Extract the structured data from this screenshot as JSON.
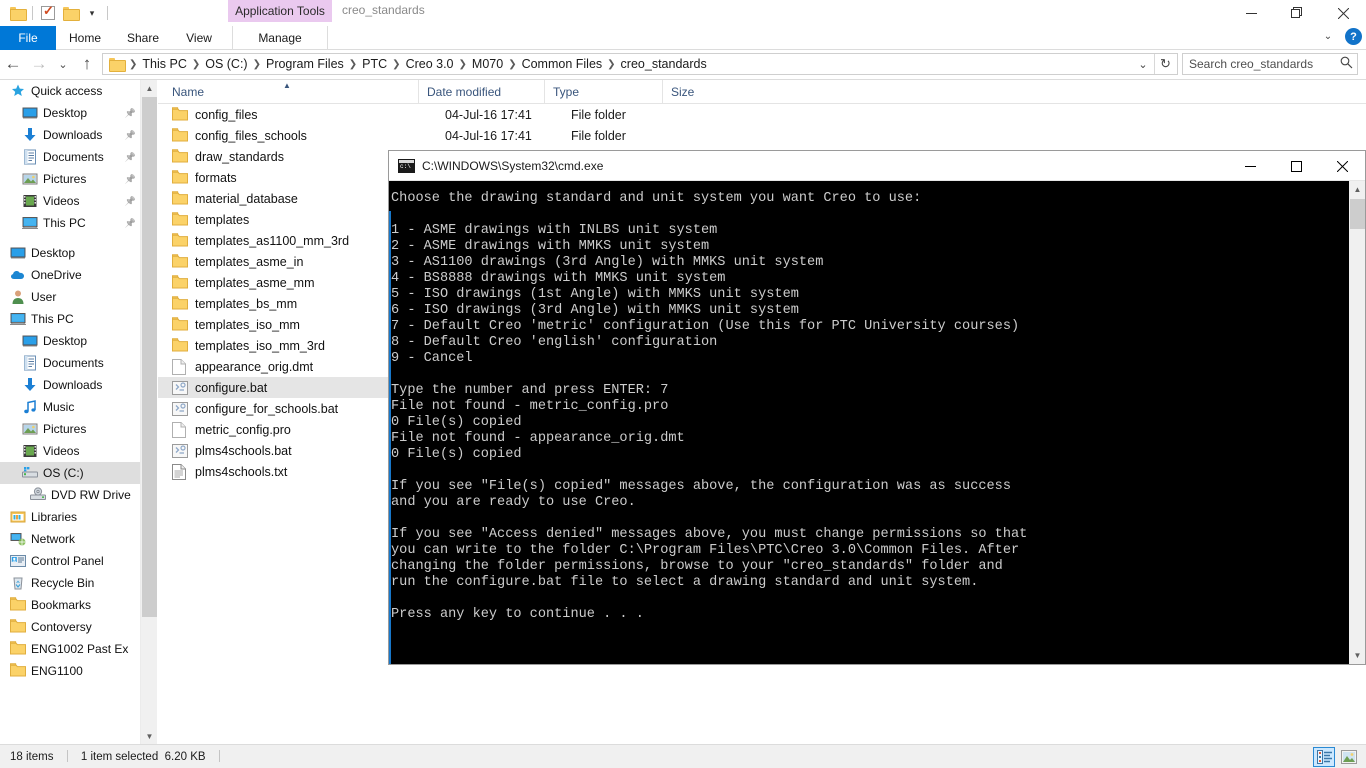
{
  "window": {
    "title": "creo_standards",
    "contextual_tab": "Application Tools",
    "minimize": "minimize",
    "restore": "restore",
    "close": "close"
  },
  "quick_access": {
    "folder_icon": "folder-icon",
    "properties_icon": "properties-icon",
    "new_folder_icon": "new-folder-icon",
    "customize_caret": "▾"
  },
  "ribbon": {
    "tabs": [
      {
        "label": "File"
      },
      {
        "label": "Home"
      },
      {
        "label": "Share"
      },
      {
        "label": "View"
      },
      {
        "label": "Manage"
      }
    ],
    "collapse_caret": "⌄",
    "help_glyph": "?"
  },
  "address": {
    "back": "←",
    "forward": "→",
    "recent_caret": "⌄",
    "up": "↑",
    "breadcrumbs": [
      "This PC",
      "OS (C:)",
      "Program Files",
      "PTC",
      "Creo 3.0",
      "M070",
      "Common Files",
      "creo_standards"
    ],
    "dropdown_caret": "⌄",
    "refresh": "↻"
  },
  "search": {
    "placeholder": "Search creo_standards",
    "value": "Search creo_standards",
    "icon": "search-icon"
  },
  "nav_pane": {
    "items": [
      {
        "label": "Quick access",
        "icon": "star-icon",
        "indent": 10,
        "pinned": false,
        "selected": false,
        "header": true
      },
      {
        "label": "Desktop",
        "icon": "desktop-icon",
        "indent": 22,
        "pinned": true,
        "selected": false
      },
      {
        "label": "Downloads",
        "icon": "download-icon",
        "indent": 22,
        "pinned": true,
        "selected": false
      },
      {
        "label": "Documents",
        "icon": "documents-icon",
        "indent": 22,
        "pinned": true,
        "selected": false
      },
      {
        "label": "Pictures",
        "icon": "pictures-icon",
        "indent": 22,
        "pinned": true,
        "selected": false
      },
      {
        "label": "Videos",
        "icon": "videos-icon",
        "indent": 22,
        "pinned": true,
        "selected": false
      },
      {
        "label": "This PC",
        "icon": "thispc-icon",
        "indent": 22,
        "pinned": true,
        "selected": false
      },
      {
        "label": "",
        "icon": "spacer",
        "indent": 0,
        "pinned": false,
        "selected": false,
        "spacer": true
      },
      {
        "label": "Desktop",
        "icon": "desktop-icon",
        "indent": 10,
        "pinned": false,
        "selected": false
      },
      {
        "label": "OneDrive",
        "icon": "onedrive-icon",
        "indent": 10,
        "pinned": false,
        "selected": false
      },
      {
        "label": "User",
        "icon": "user-icon",
        "indent": 10,
        "pinned": false,
        "selected": false
      },
      {
        "label": "This PC",
        "icon": "thispc-icon",
        "indent": 10,
        "pinned": false,
        "selected": false
      },
      {
        "label": "Desktop",
        "icon": "desktop-icon",
        "indent": 22,
        "pinned": false,
        "selected": false
      },
      {
        "label": "Documents",
        "icon": "documents-icon",
        "indent": 22,
        "pinned": false,
        "selected": false
      },
      {
        "label": "Downloads",
        "icon": "download-icon",
        "indent": 22,
        "pinned": false,
        "selected": false
      },
      {
        "label": "Music",
        "icon": "music-icon",
        "indent": 22,
        "pinned": false,
        "selected": false
      },
      {
        "label": "Pictures",
        "icon": "pictures-icon",
        "indent": 22,
        "pinned": false,
        "selected": false
      },
      {
        "label": "Videos",
        "icon": "videos-icon",
        "indent": 22,
        "pinned": false,
        "selected": false
      },
      {
        "label": "OS (C:)",
        "icon": "drive-icon",
        "indent": 22,
        "pinned": false,
        "selected": true
      },
      {
        "label": "DVD RW Drive",
        "icon": "dvd-icon",
        "indent": 30,
        "pinned": false,
        "selected": false
      },
      {
        "label": "Libraries",
        "icon": "libraries-icon",
        "indent": 10,
        "pinned": false,
        "selected": false
      },
      {
        "label": "Network",
        "icon": "network-icon",
        "indent": 10,
        "pinned": false,
        "selected": false
      },
      {
        "label": "Control Panel",
        "icon": "control-panel-icon",
        "indent": 10,
        "pinned": false,
        "selected": false
      },
      {
        "label": "Recycle Bin",
        "icon": "recycle-bin-icon",
        "indent": 10,
        "pinned": false,
        "selected": false
      },
      {
        "label": "Bookmarks",
        "icon": "folder-icon",
        "indent": 10,
        "pinned": false,
        "selected": false
      },
      {
        "label": "Contoversy",
        "icon": "folder-icon",
        "indent": 10,
        "pinned": false,
        "selected": false
      },
      {
        "label": "ENG1002 Past Ex",
        "icon": "folder-icon",
        "indent": 10,
        "pinned": false,
        "selected": false
      },
      {
        "label": "ENG1100",
        "icon": "folder-icon",
        "indent": 10,
        "pinned": false,
        "selected": false
      }
    ]
  },
  "file_list": {
    "columns": [
      {
        "label": "Name",
        "sorted": true
      },
      {
        "label": "Date modified",
        "sorted": false
      },
      {
        "label": "Type",
        "sorted": false
      },
      {
        "label": "Size",
        "sorted": false
      }
    ],
    "rows": [
      {
        "name": "config_files",
        "date": "04-Jul-16 17:41",
        "type": "File folder",
        "size": "",
        "icon": "folder-icon",
        "selected": false
      },
      {
        "name": "config_files_schools",
        "date": "04-Jul-16 17:41",
        "type": "File folder",
        "size": "",
        "icon": "folder-icon",
        "selected": false
      },
      {
        "name": "draw_standards",
        "date": "",
        "type": "",
        "size": "",
        "icon": "folder-icon",
        "selected": false
      },
      {
        "name": "formats",
        "date": "",
        "type": "",
        "size": "",
        "icon": "folder-icon",
        "selected": false
      },
      {
        "name": "material_database",
        "date": "",
        "type": "",
        "size": "",
        "icon": "folder-icon",
        "selected": false
      },
      {
        "name": "templates",
        "date": "",
        "type": "",
        "size": "",
        "icon": "folder-icon",
        "selected": false
      },
      {
        "name": "templates_as1100_mm_3rd",
        "date": "",
        "type": "",
        "size": "",
        "icon": "folder-icon",
        "selected": false
      },
      {
        "name": "templates_asme_in",
        "date": "",
        "type": "",
        "size": "",
        "icon": "folder-icon",
        "selected": false
      },
      {
        "name": "templates_asme_mm",
        "date": "",
        "type": "",
        "size": "",
        "icon": "folder-icon",
        "selected": false
      },
      {
        "name": "templates_bs_mm",
        "date": "",
        "type": "",
        "size": "",
        "icon": "folder-icon",
        "selected": false
      },
      {
        "name": "templates_iso_mm",
        "date": "",
        "type": "",
        "size": "",
        "icon": "folder-icon",
        "selected": false
      },
      {
        "name": "templates_iso_mm_3rd",
        "date": "",
        "type": "",
        "size": "",
        "icon": "folder-icon",
        "selected": false
      },
      {
        "name": "appearance_orig.dmt",
        "date": "",
        "type": "",
        "size": "",
        "icon": "document-icon",
        "selected": false
      },
      {
        "name": "configure.bat",
        "date": "",
        "type": "",
        "size": "",
        "icon": "bat-icon",
        "selected": true
      },
      {
        "name": "configure_for_schools.bat",
        "date": "",
        "type": "",
        "size": "",
        "icon": "bat-icon",
        "selected": false
      },
      {
        "name": "metric_config.pro",
        "date": "",
        "type": "",
        "size": "",
        "icon": "document-icon",
        "selected": false
      },
      {
        "name": "plms4schools.bat",
        "date": "",
        "type": "",
        "size": "",
        "icon": "bat-icon",
        "selected": false
      },
      {
        "name": "plms4schools.txt",
        "date": "",
        "type": "",
        "size": "",
        "icon": "text-icon",
        "selected": false
      }
    ]
  },
  "status_bar": {
    "item_count": "18 items",
    "selection": "1 item selected",
    "selection_size": "6.20 KB",
    "details_view_icon": "details-view-icon",
    "large_icons_view_icon": "large-icons-view-icon"
  },
  "cmd_window": {
    "title": "C:\\WINDOWS\\System32\\cmd.exe",
    "icon": "cmd-icon",
    "minimize": "minimize",
    "maximize": "maximize",
    "close": "close",
    "scroll_up": "▲",
    "scroll_down": "▼",
    "output": "Choose the drawing standard and unit system you want Creo to use:\n\n1 - ASME drawings with INLBS unit system\n2 - ASME drawings with MMKS unit system\n3 - AS1100 drawings (3rd Angle) with MMKS unit system\n4 - BS8888 drawings with MMKS unit system\n5 - ISO drawings (1st Angle) with MMKS unit system\n6 - ISO drawings (3rd Angle) with MMKS unit system\n7 - Default Creo 'metric' configuration (Use this for PTC University courses)\n8 - Default Creo 'english' configuration\n9 - Cancel\n\nType the number and press ENTER: 7\nFile not found - metric_config.pro\n0 File(s) copied\nFile not found - appearance_orig.dmt\n0 File(s) copied\n\nIf you see \"File(s) copied\" messages above, the configuration was as success\nand you are ready to use Creo.\n\nIf you see \"Access denied\" messages above, you must change permissions so that\nyou can write to the folder C:\\Program Files\\PTC\\Creo 3.0\\Common Files. After\nchanging the folder permissions, browse to your \"creo_standards\" folder and\nrun the configure.bat file to select a drawing standard and unit system.\n\nPress any key to continue . . ."
  },
  "colors": {
    "accent": "#0078d7",
    "contextual_tab": "#eac9ef",
    "selection": "#e5e5e5",
    "column_header_text": "#39557c"
  }
}
